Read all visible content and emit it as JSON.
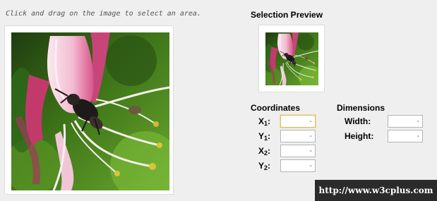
{
  "instruction": "Click and drag on the image to select an area.",
  "preview": {
    "title": "Selection Preview"
  },
  "coordinates": {
    "title": "Coordinates",
    "fields": [
      {
        "letter": "X",
        "sub": "1",
        "colon": ":",
        "value": "",
        "placeholder": "-"
      },
      {
        "letter": "Y",
        "sub": "1",
        "colon": ":",
        "value": "",
        "placeholder": "-"
      },
      {
        "letter": "X",
        "sub": "2",
        "colon": ":",
        "value": "",
        "placeholder": "-"
      },
      {
        "letter": "Y",
        "sub": "2",
        "colon": ":",
        "value": "",
        "placeholder": "-"
      }
    ]
  },
  "dimensions": {
    "title": "Dimensions",
    "width": {
      "label": "Width:",
      "value": "",
      "placeholder": "-"
    },
    "height": {
      "label": "Height:",
      "value": "",
      "placeholder": "-"
    }
  },
  "watermark": "http://www.w3cplus.com",
  "colors": {
    "background": "#efefef",
    "focus_border": "#e3b96a",
    "watermark_bg": "#2b2b2b",
    "petal_pink": "#e8a6c0",
    "foliage_green": "#4f8a22"
  }
}
